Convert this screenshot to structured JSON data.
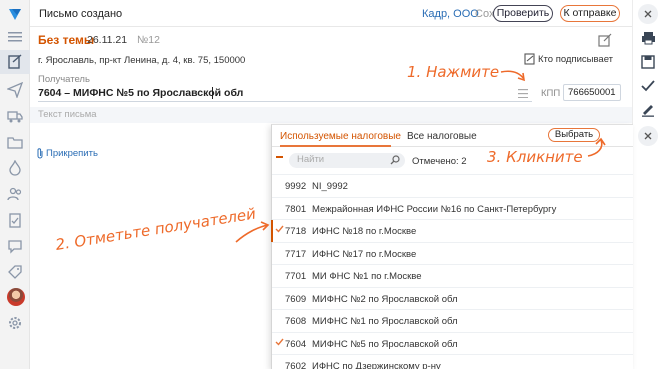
{
  "header": {
    "title": "Письмо создано",
    "org": "Кадр, ООО",
    "save_label": "Сохранить",
    "check_label": "Проверить",
    "send_label": "К отправке"
  },
  "document": {
    "subject": "Без темы",
    "date": "26.11.21",
    "number": "№12",
    "address": "г. Ярославль, пр-кт Ленина, д. 4, кв. 75, 150000",
    "signer_link": "Кто подписывает",
    "recipient_label": "Получатель",
    "recipient_value": "7604 – МИФНС №5 по Ярославской обл",
    "kpp_label": "КПП",
    "kpp_value": "766650001",
    "letter_placeholder": "Текст письма",
    "attach_label": "Прикрепить"
  },
  "popup": {
    "tab_used": "Используемые налоговые",
    "tab_all": "Все налоговые",
    "choose_label": "Выбрать",
    "search_placeholder": "Найти",
    "marked_text": "Отмечено: 2",
    "rows": [
      {
        "code": "9992",
        "name": "NI_9992",
        "selected": false
      },
      {
        "code": "7801",
        "name": "Межрайонная ИФНС России №16 по Санкт-Петербургу",
        "selected": false
      },
      {
        "code": "7718",
        "name": "ИФНС №18 по г.Москве",
        "selected": true
      },
      {
        "code": "7717",
        "name": "ИФНС №17 по г.Москве",
        "selected": false
      },
      {
        "code": "7701",
        "name": "МИ ФНС №1 по г.Москве",
        "selected": false
      },
      {
        "code": "7609",
        "name": "МИФНС №2 по Ярославской обл",
        "selected": false
      },
      {
        "code": "7608",
        "name": "МИФНС №1 по Ярославской обл",
        "selected": false
      },
      {
        "code": "7604",
        "name": "МИФНС №5 по Ярославской обл",
        "selected": true
      },
      {
        "code": "7602",
        "name": "ИФНС по Дзержинскому р-ну",
        "selected": false
      }
    ]
  },
  "annotations": {
    "step1": "1. Нажмите",
    "step2": "2. Отметьте получателей",
    "step3": "3. Кликните"
  },
  "colors": {
    "accent": "#e8763a",
    "link": "#2a6db5",
    "annotation": "#ee6a2a"
  },
  "icons": {
    "rail": [
      "logo-icon",
      "menu-icon",
      "document-edit-icon",
      "send-icon",
      "truck-icon",
      "folder-icon",
      "fire-icon",
      "people-icon",
      "checklist-icon",
      "chat-icon",
      "tag-icon",
      "settings-icon"
    ],
    "right": [
      "close-icon",
      "print-icon",
      "save-icon",
      "check-icon",
      "sign-icon",
      "close-icon"
    ]
  }
}
